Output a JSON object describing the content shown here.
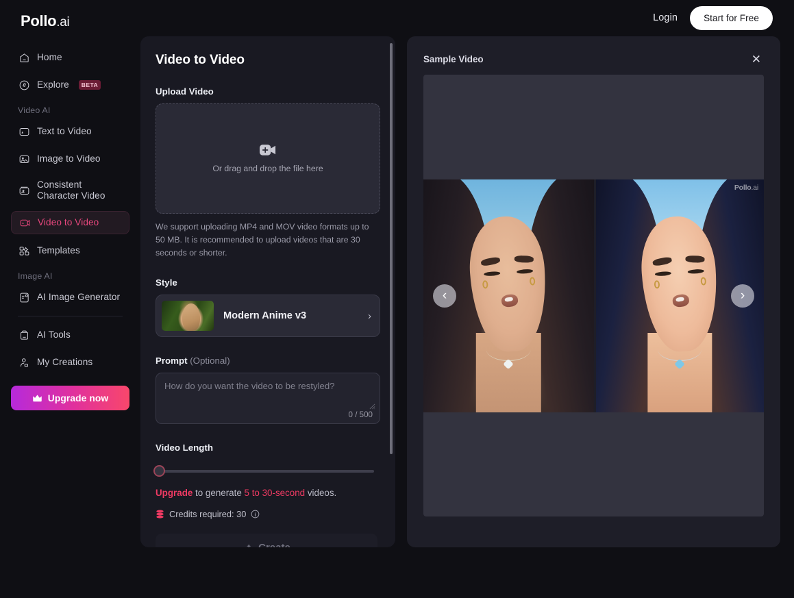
{
  "brand": {
    "name": "Pollo",
    "suffix": ".ai"
  },
  "topbar": {
    "login_label": "Login",
    "cta_label": "Start for Free"
  },
  "sidebar": {
    "items_top": [
      {
        "label": "Home",
        "icon": "home-icon"
      },
      {
        "label": "Explore",
        "icon": "compass-icon",
        "badge": "BETA"
      }
    ],
    "section_video_label": "Video AI",
    "video_items": [
      {
        "label": "Text to Video",
        "icon": "text-to-video-icon"
      },
      {
        "label": "Image to Video",
        "icon": "image-to-video-icon"
      },
      {
        "label": "Consistent Character Video",
        "icon": "consistent-character-icon"
      },
      {
        "label": "Video to Video",
        "icon": "video-to-video-icon",
        "active": true
      },
      {
        "label": "Templates",
        "icon": "templates-icon"
      }
    ],
    "section_image_label": "Image AI",
    "image_items": [
      {
        "label": "AI Image Generator",
        "icon": "ai-image-generator-icon"
      }
    ],
    "tool_items": [
      {
        "label": "AI Tools",
        "icon": "ai-tools-icon"
      },
      {
        "label": "My Creations",
        "icon": "my-creations-icon"
      }
    ],
    "upgrade_label": "Upgrade now",
    "upgrade_icon": "crown-icon"
  },
  "form": {
    "title": "Video to Video",
    "upload_label": "Upload Video",
    "dropzone_hint": "Or drag and drop the file here",
    "dropzone_icon": "video-plus-icon",
    "support_note": "We support uploading MP4 and MOV video formats up to 50 MB. It is recommended to upload videos that are 30 seconds or shorter.",
    "style_label": "Style",
    "style_value": "Modern Anime v3",
    "prompt_label": "Prompt",
    "prompt_optional": "(Optional)",
    "prompt_value": "",
    "prompt_placeholder": "How do you want the video to be restyled?",
    "prompt_counter": "0 / 500",
    "video_length_label": "Video Length",
    "slider_value": 0,
    "upgrade_note_link": "Upgrade",
    "upgrade_note_mid": " to generate ",
    "upgrade_note_duration": "5 to 30-second",
    "upgrade_note_end": " videos.",
    "credits_text": "Credits required: 30",
    "create_label": "Create"
  },
  "preview": {
    "title": "Sample Video",
    "close_icon": "close-icon",
    "prev_icon": "chevron-left-icon",
    "next_icon": "chevron-right-icon",
    "watermark_name": "Pollo",
    "watermark_suffix": ".ai"
  },
  "colors": {
    "accent_pink": "#ef3a63",
    "active_nav": "#e8477d",
    "page_bg": "#0f0f14",
    "panel_bg": "#191922",
    "preview_bg": "#1e1e28"
  }
}
